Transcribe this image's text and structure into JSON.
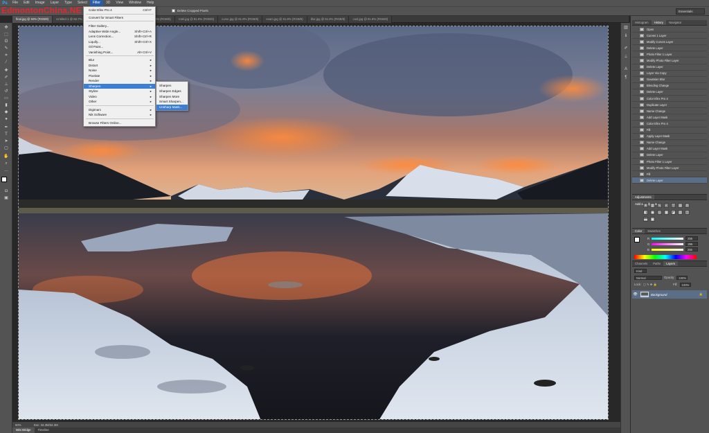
{
  "app": {
    "logo": "Ps"
  },
  "watermark": "EdmontonChina.NET",
  "menu": [
    "File",
    "Edit",
    "Image",
    "Layer",
    "Type",
    "Select",
    "Filter",
    "3D",
    "View",
    "Window",
    "Help"
  ],
  "options": {
    "delete_cropped": "Delete Cropped Pixels",
    "workspace": "Essentials"
  },
  "tabs": [
    "final.jpg @ 50% (RGB/8)",
    "Untitled-1 @ 66.7% (RGB/8)",
    "1 @ 81.8% (RGB/8)",
    "tuna.jpg @ 81.8% (RGB/8)",
    "rotel.jpg @ 81.8% (RGB/8)",
    "curve.jpg @ 81.8% (RGB/8)",
    "exam.jpg @ 81.8% (RGB/8)",
    "blur.jpg @ 81.8% (RGB/8)",
    "cool.jpg @ 81.8% (RGB/8)"
  ],
  "filter_menu": {
    "items": [
      {
        "label": "Color Efex Pro 4",
        "shortcut": "Ctrl+F"
      },
      {
        "label": "Convert for Smart Filters",
        "shortcut": ""
      },
      {
        "label": "Filter Gallery...",
        "shortcut": ""
      },
      {
        "label": "Adaptive Wide Angle...",
        "shortcut": "Shift+Ctrl+A"
      },
      {
        "label": "Lens Correction...",
        "shortcut": "Shift+Ctrl+R"
      },
      {
        "label": "Liquify...",
        "shortcut": "Shift+Ctrl+X"
      },
      {
        "label": "Oil Paint...",
        "shortcut": ""
      },
      {
        "label": "Vanishing Point...",
        "shortcut": "Alt+Ctrl+V"
      },
      {
        "label": "Blur",
        "shortcut": "▸"
      },
      {
        "label": "Distort",
        "shortcut": "▸"
      },
      {
        "label": "Noise",
        "shortcut": "▸"
      },
      {
        "label": "Pixelate",
        "shortcut": "▸"
      },
      {
        "label": "Render",
        "shortcut": "▸"
      },
      {
        "label": "Sharpen",
        "shortcut": "▸"
      },
      {
        "label": "Stylize",
        "shortcut": "▸"
      },
      {
        "label": "Video",
        "shortcut": "▸"
      },
      {
        "label": "Other",
        "shortcut": "▸"
      },
      {
        "label": "Digimarc",
        "shortcut": "▸"
      },
      {
        "label": "Nik Software",
        "shortcut": "▸"
      },
      {
        "label": "Browse Filters Online...",
        "shortcut": ""
      }
    ]
  },
  "sharpen_menu": [
    "Sharpen",
    "Sharpen Edges",
    "Sharpen More",
    "Smart Sharpen...",
    "Unsharp Mask..."
  ],
  "panels": {
    "top_tabs": [
      "Histogram",
      "History",
      "Navigator"
    ],
    "history": [
      "Open",
      "Curves 1 Layer",
      "Modify Curves Layer",
      "Delete Layer",
      "Photo Filter 1 Layer",
      "Modify Photo Filter Layer",
      "Delete Layer",
      "Layer Via Copy",
      "Gaussian Blur",
      "Blending Change",
      "Delete Layer",
      "Color Efex Pro 4",
      "Duplicate Layer",
      "Name Change",
      "Add Layer Mask",
      "Color Efex Pro 4",
      "Fill",
      "Apply Layer Mask",
      "Name Change",
      "Add Layer Mask",
      "Delete Layer",
      "Photo Filter 1 Layer",
      "Modify Photo Filter Layer",
      "Fill",
      "Delete Layer"
    ],
    "adjustments": {
      "tab": "Adjustments",
      "title": "Add an adjustment"
    },
    "color": {
      "tabs": [
        "Color",
        "Swatches"
      ],
      "r": "255",
      "g": "255",
      "b": "255",
      "r_label": "R",
      "g_label": "G",
      "b_label": "B"
    },
    "layers": {
      "tabs": [
        "Channels",
        "Paths",
        "Layers"
      ],
      "kind": "Kind",
      "blend": "Normal",
      "opacity_label": "Opacity:",
      "opacity": "100%",
      "lock_label": "Lock:",
      "fill_label": "Fill:",
      "fill": "100%",
      "layer_name": "Background"
    }
  },
  "status": {
    "zoom": "50%",
    "doc": "Doc: 34.3M/34.3M"
  },
  "bottom_tabs": [
    "Mini Bridge",
    "Timeline"
  ]
}
